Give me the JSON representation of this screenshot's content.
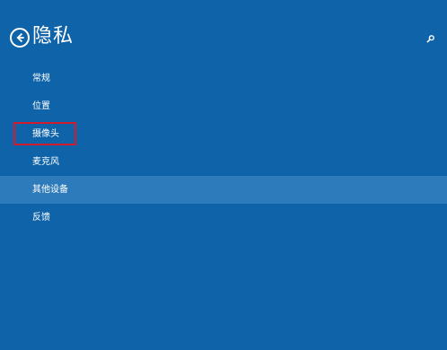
{
  "header": {
    "title": "隐私",
    "back_icon": "back-arrow-circle-icon",
    "search_icon": "search-icon"
  },
  "nav": {
    "items": [
      {
        "label": "常规",
        "selected": false
      },
      {
        "label": "位置",
        "selected": false
      },
      {
        "label": "摄像头",
        "selected": false,
        "highlighted": true
      },
      {
        "label": "麦克风",
        "selected": false
      },
      {
        "label": "其他设备",
        "selected": true
      },
      {
        "label": "反馈",
        "selected": false
      }
    ]
  },
  "colors": {
    "background": "#0f63a8",
    "selected_row": "#2e7bbb",
    "highlight_box": "#d21b2d",
    "text": "#ffffff"
  }
}
